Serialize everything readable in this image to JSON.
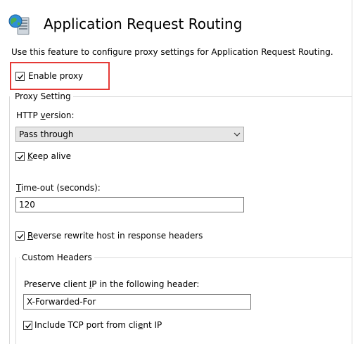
{
  "header": {
    "icon": "globe-server-icon",
    "title": "Application Request Routing",
    "description": "Use this feature to configure proxy settings for Application Request Routing."
  },
  "enable_proxy": {
    "label": "Enable proxy",
    "checked": true
  },
  "proxy_setting": {
    "group_title": "Proxy Setting",
    "http_version": {
      "label": "HTTP version:",
      "value": "Pass through"
    },
    "keep_alive": {
      "label": "Keep alive",
      "checked": true
    },
    "timeout": {
      "label": "Time-out (seconds):",
      "value": "120"
    },
    "reverse_rewrite": {
      "label": "Reverse rewrite host in response headers",
      "checked": true
    }
  },
  "custom_headers": {
    "group_title": "Custom Headers",
    "preserve_ip": {
      "label": "Preserve client IP in the following header:",
      "value": "X-Forwarded-For"
    },
    "include_tcp_port": {
      "label": "Include TCP port from client IP",
      "checked": true
    }
  },
  "colors": {
    "highlight": "#e53935",
    "group_line": "#d9d9d9",
    "select_bg": "#e6e6e6"
  }
}
